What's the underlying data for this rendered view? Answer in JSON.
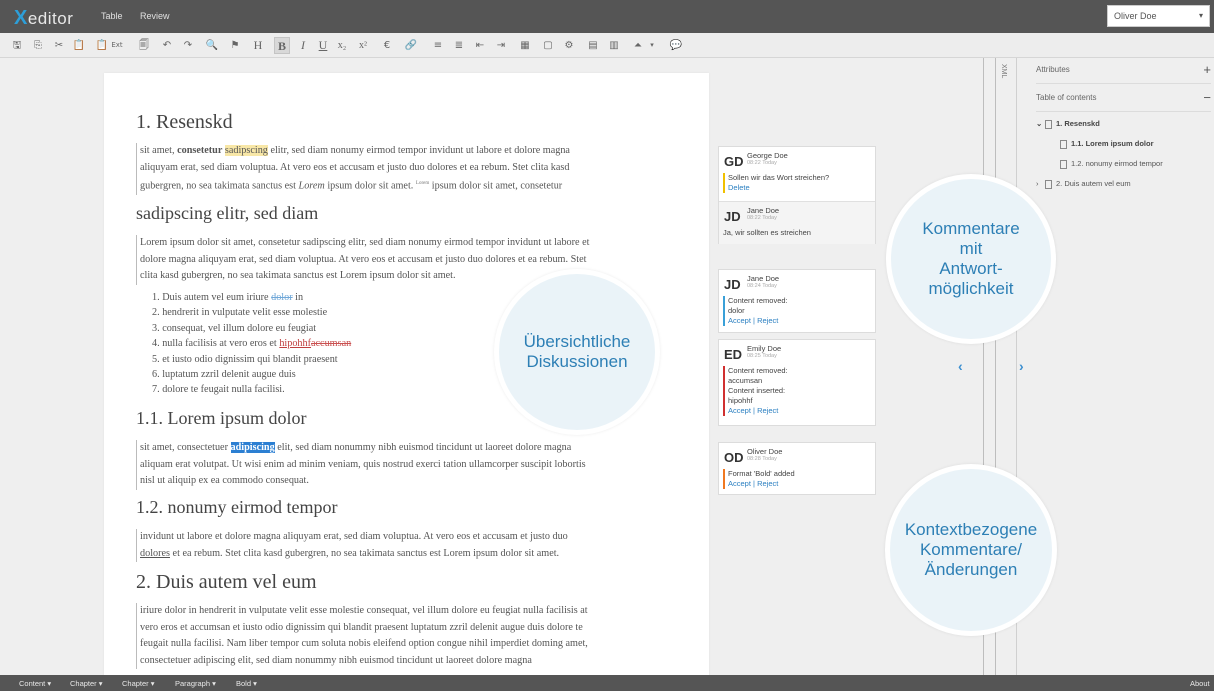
{
  "app": {
    "logo_x": "X",
    "logo_rest": "editor"
  },
  "menu": {
    "table": "Table",
    "review": "Review"
  },
  "user": {
    "name": "Oliver Doe",
    "caret": "▾"
  },
  "toolbar": {
    "buttons": [
      "🖫",
      "⎘",
      "✂",
      "📋",
      "📋",
      "Ext",
      "🗐",
      "↶",
      "↷",
      "🔍",
      "⚑",
      "H",
      "B",
      "I",
      "U",
      "x₂",
      "x²",
      "€",
      "🔗",
      "≡",
      "≣",
      "⇤",
      "⇥",
      "▦",
      "▢",
      "⚙",
      "▤",
      "▥",
      "⏶",
      "▾",
      "💬"
    ]
  },
  "doc": {
    "h1_1": "1. Resenskd",
    "p1": {
      "a": "sit amet, ",
      "b": "consetetur",
      "c": " ",
      "d": "sadipscing",
      "e": " elitr, sed diam nonumy eirmod tempor invidunt ut labore et dolore magna",
      "line2": "aliquyam erat, sed diam voluptua. At vero eos et accusam et justo duo dolores et ea rebum. Stet clita kasd",
      "line3a": "gubergren, no sea takimata sanctus est ",
      "line3b": "Lorem",
      "line3c": " ipsum dolor sit amet. ",
      "line3sup": "Lorem",
      "line3d": " ipsum dolor sit amet, consetetur"
    },
    "h2_1": "sadipscing elitr, sed diam",
    "p2": {
      "line1": "Lorem ipsum dolor sit amet, consetetur sadipscing elitr, sed diam nonumy eirmod tempor invidunt ut labore et",
      "line2": "dolore magna aliquyam erat, sed diam voluptua. At vero eos et accusam et justo duo dolores et ea rebum. Stet",
      "line3": "clita kasd gubergren, no sea takimata sanctus est Lorem ipsum dolor sit amet."
    },
    "list": {
      "i1a": "1. Duis autem vel eum iriure ",
      "i1b": "dolor",
      "i1c": " in",
      "i2": "2. hendrerit in vulputate velit esse molestie",
      "i3": "3. consequat, vel illum dolore eu feugiat",
      "i4a": "4. nulla facilisis at vero eros et ",
      "i4b": "hipohhf",
      "i4c": "accumsan",
      "i5": "5. et iusto odio dignissim qui blandit praesent",
      "i6": "6. luptatum zzril delenit augue duis",
      "i7": "7. dolore te feugait nulla facilisi."
    },
    "h2_2": "1.1. Lorem ipsum dolor",
    "p3": {
      "a": "sit amet, consectetuer ",
      "b": "adipiscing",
      "c": " elit, sed diam nonummy nibh euismod tincidunt ut laoreet dolore magna",
      "line2": "aliquam erat volutpat. Ut wisi enim ad minim veniam, quis nostrud exerci tation ullamcorper suscipit lobortis",
      "line3": "nisl ut aliquip ex ea commodo consequat."
    },
    "h2_3": "1.2. nonumy eirmod tempor",
    "p4": {
      "line1": "invidunt ut labore et dolore magna aliquyam erat, sed diam voluptua. At vero eos et accusam et justo duo",
      "line2a": "dolores",
      "line2b": " et ea rebum. Stet clita kasd gubergren, no sea takimata sanctus est Lorem ipsum dolor sit amet."
    },
    "h1_2": "2. Duis autem vel eum",
    "p5": {
      "line1": "iriure dolor in hendrerit in vulputate velit esse molestie consequat, vel illum dolore eu feugiat nulla facilisis at",
      "line2": "vero eros et accumsan et iusto odio dignissim qui blandit praesent luptatum zzril delenit augue duis dolore te",
      "line3": "feugait nulla facilisi. Nam liber tempor cum soluta nobis eleifend option congue nihil imperdiet doming amet,",
      "line4": "consectetuer adipiscing elit, sed diam nonummy nibh euismod tincidunt ut laoreet dolore magna"
    }
  },
  "comments": {
    "c1": {
      "initials": "GD",
      "author": "George Doe",
      "time": "08:22 Today",
      "text": "Sollen wir das Wort streichen?",
      "action": "Delete",
      "reply": {
        "initials": "JD",
        "author": "Jane Doe",
        "time": "08:22 Today",
        "text": "Ja, wir sollten es streichen"
      }
    },
    "c2": {
      "initials": "JD",
      "author": "Jane Doe",
      "time": "08:24 Today",
      "l1": "Content removed:",
      "l2": "dolor",
      "accept": "Accept",
      "sep": " | ",
      "reject": "Reject"
    },
    "c3": {
      "initials": "ED",
      "author": "Emily Doe",
      "time": "08:25 Today",
      "l1": "Content removed:",
      "l2": "accumsan",
      "l3": "Content inserted:",
      "l4": "hipohhf",
      "accept": "Accept",
      "sep": " | ",
      "reject": "Reject"
    },
    "c4": {
      "initials": "OD",
      "author": "Oliver Doe",
      "time": "08:28 Today",
      "l1": "Format 'Bold' added",
      "accept": "Accept",
      "sep": " | ",
      "reject": "Reject"
    }
  },
  "bubbles": {
    "b1": {
      "l1": "Übersichtliche",
      "l2": "Diskussionen"
    },
    "b2": {
      "l1": "Kommentare",
      "l2": "mit",
      "l3": "Antwort-",
      "l4": "möglichkeit"
    },
    "b3": {
      "l1": "Kontextbezogene",
      "l2": "Kommentare/",
      "l3": "Änderungen"
    }
  },
  "side": {
    "xml": "XML",
    "left_chev": "‹",
    "right_chev": "›"
  },
  "panel": {
    "attributes": "Attributes",
    "attr_sign": "+",
    "toc": "Table of contents",
    "toc_sign": "−",
    "items": [
      {
        "arrow": "⌄",
        "label": "1. Resenskd"
      },
      {
        "arrow": "",
        "label": "1.1. Lorem ipsum dolor"
      },
      {
        "arrow": "",
        "label": "1.2. nonumy eirmod tempor"
      },
      {
        "arrow": "›",
        "label": "2. Duis autem vel eum"
      }
    ]
  },
  "bottom": {
    "items": [
      "Content ▾",
      "Chapter ▾",
      "Chapter ▾",
      "Paragraph ▾",
      "Bold ▾"
    ],
    "about": "About"
  },
  "colors": {
    "accent": "#2d7fb5",
    "bar": "#555555"
  }
}
